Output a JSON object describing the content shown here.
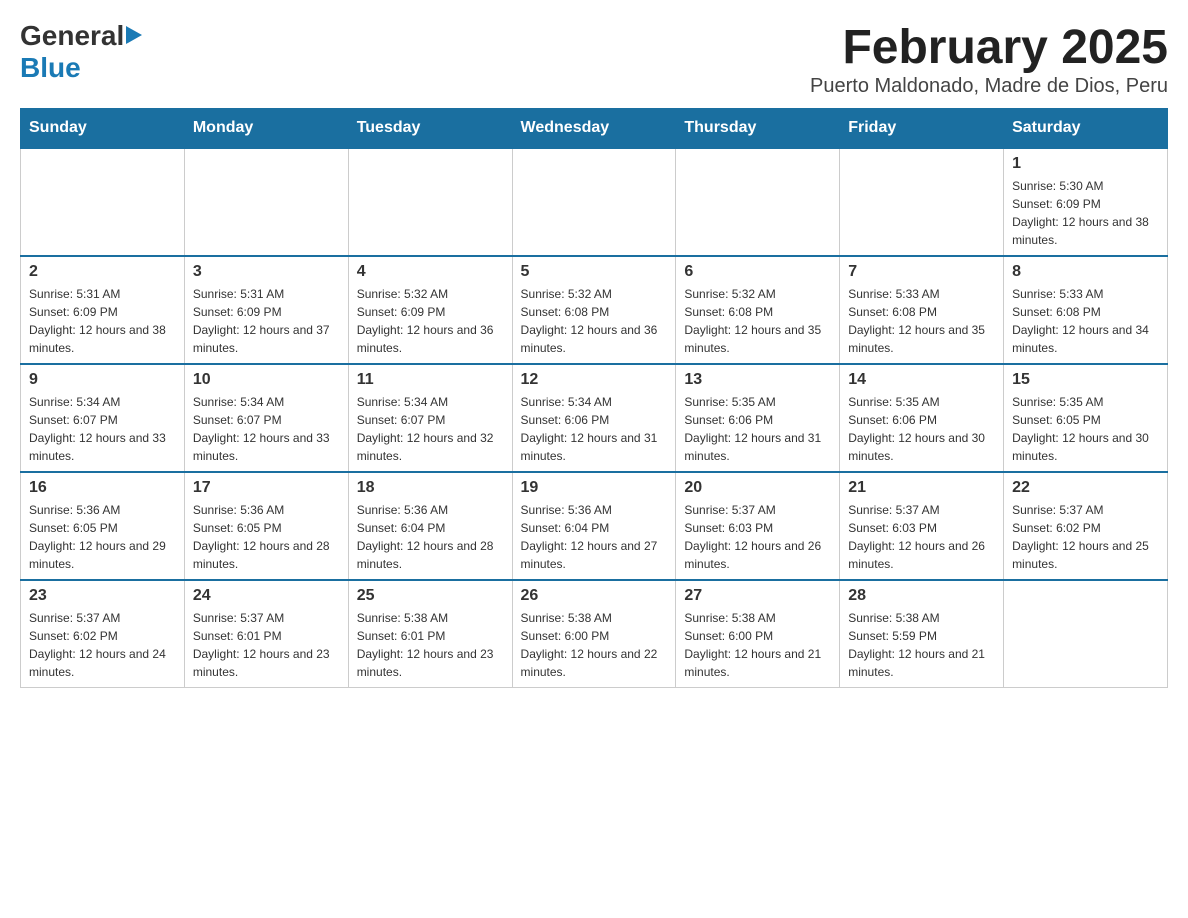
{
  "header": {
    "logo": {
      "general": "General",
      "blue": "Blue",
      "arrow": "▶"
    },
    "title": "February 2025",
    "subtitle": "Puerto Maldonado, Madre de Dios, Peru"
  },
  "calendar": {
    "weekdays": [
      "Sunday",
      "Monday",
      "Tuesday",
      "Wednesday",
      "Thursday",
      "Friday",
      "Saturday"
    ],
    "weeks": [
      [
        {
          "day": "",
          "info": ""
        },
        {
          "day": "",
          "info": ""
        },
        {
          "day": "",
          "info": ""
        },
        {
          "day": "",
          "info": ""
        },
        {
          "day": "",
          "info": ""
        },
        {
          "day": "",
          "info": ""
        },
        {
          "day": "1",
          "info": "Sunrise: 5:30 AM\nSunset: 6:09 PM\nDaylight: 12 hours and 38 minutes."
        }
      ],
      [
        {
          "day": "2",
          "info": "Sunrise: 5:31 AM\nSunset: 6:09 PM\nDaylight: 12 hours and 38 minutes."
        },
        {
          "day": "3",
          "info": "Sunrise: 5:31 AM\nSunset: 6:09 PM\nDaylight: 12 hours and 37 minutes."
        },
        {
          "day": "4",
          "info": "Sunrise: 5:32 AM\nSunset: 6:09 PM\nDaylight: 12 hours and 36 minutes."
        },
        {
          "day": "5",
          "info": "Sunrise: 5:32 AM\nSunset: 6:08 PM\nDaylight: 12 hours and 36 minutes."
        },
        {
          "day": "6",
          "info": "Sunrise: 5:32 AM\nSunset: 6:08 PM\nDaylight: 12 hours and 35 minutes."
        },
        {
          "day": "7",
          "info": "Sunrise: 5:33 AM\nSunset: 6:08 PM\nDaylight: 12 hours and 35 minutes."
        },
        {
          "day": "8",
          "info": "Sunrise: 5:33 AM\nSunset: 6:08 PM\nDaylight: 12 hours and 34 minutes."
        }
      ],
      [
        {
          "day": "9",
          "info": "Sunrise: 5:34 AM\nSunset: 6:07 PM\nDaylight: 12 hours and 33 minutes."
        },
        {
          "day": "10",
          "info": "Sunrise: 5:34 AM\nSunset: 6:07 PM\nDaylight: 12 hours and 33 minutes."
        },
        {
          "day": "11",
          "info": "Sunrise: 5:34 AM\nSunset: 6:07 PM\nDaylight: 12 hours and 32 minutes."
        },
        {
          "day": "12",
          "info": "Sunrise: 5:34 AM\nSunset: 6:06 PM\nDaylight: 12 hours and 31 minutes."
        },
        {
          "day": "13",
          "info": "Sunrise: 5:35 AM\nSunset: 6:06 PM\nDaylight: 12 hours and 31 minutes."
        },
        {
          "day": "14",
          "info": "Sunrise: 5:35 AM\nSunset: 6:06 PM\nDaylight: 12 hours and 30 minutes."
        },
        {
          "day": "15",
          "info": "Sunrise: 5:35 AM\nSunset: 6:05 PM\nDaylight: 12 hours and 30 minutes."
        }
      ],
      [
        {
          "day": "16",
          "info": "Sunrise: 5:36 AM\nSunset: 6:05 PM\nDaylight: 12 hours and 29 minutes."
        },
        {
          "day": "17",
          "info": "Sunrise: 5:36 AM\nSunset: 6:05 PM\nDaylight: 12 hours and 28 minutes."
        },
        {
          "day": "18",
          "info": "Sunrise: 5:36 AM\nSunset: 6:04 PM\nDaylight: 12 hours and 28 minutes."
        },
        {
          "day": "19",
          "info": "Sunrise: 5:36 AM\nSunset: 6:04 PM\nDaylight: 12 hours and 27 minutes."
        },
        {
          "day": "20",
          "info": "Sunrise: 5:37 AM\nSunset: 6:03 PM\nDaylight: 12 hours and 26 minutes."
        },
        {
          "day": "21",
          "info": "Sunrise: 5:37 AM\nSunset: 6:03 PM\nDaylight: 12 hours and 26 minutes."
        },
        {
          "day": "22",
          "info": "Sunrise: 5:37 AM\nSunset: 6:02 PM\nDaylight: 12 hours and 25 minutes."
        }
      ],
      [
        {
          "day": "23",
          "info": "Sunrise: 5:37 AM\nSunset: 6:02 PM\nDaylight: 12 hours and 24 minutes."
        },
        {
          "day": "24",
          "info": "Sunrise: 5:37 AM\nSunset: 6:01 PM\nDaylight: 12 hours and 23 minutes."
        },
        {
          "day": "25",
          "info": "Sunrise: 5:38 AM\nSunset: 6:01 PM\nDaylight: 12 hours and 23 minutes."
        },
        {
          "day": "26",
          "info": "Sunrise: 5:38 AM\nSunset: 6:00 PM\nDaylight: 12 hours and 22 minutes."
        },
        {
          "day": "27",
          "info": "Sunrise: 5:38 AM\nSunset: 6:00 PM\nDaylight: 12 hours and 21 minutes."
        },
        {
          "day": "28",
          "info": "Sunrise: 5:38 AM\nSunset: 5:59 PM\nDaylight: 12 hours and 21 minutes."
        },
        {
          "day": "",
          "info": ""
        }
      ]
    ]
  }
}
